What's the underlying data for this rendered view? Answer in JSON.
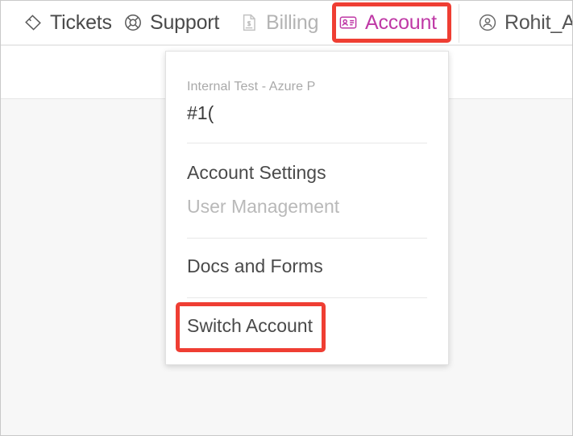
{
  "top_nav": {
    "items": [
      {
        "id": "tickets",
        "label": "Tickets",
        "icon": "ticket-icon",
        "state": "default"
      },
      {
        "id": "support",
        "label": "Support",
        "icon": "lifebuoy-icon",
        "state": "default"
      },
      {
        "id": "billing",
        "label": "Billing",
        "icon": "invoice-icon",
        "state": "disabled"
      },
      {
        "id": "account",
        "label": "Account",
        "icon": "id-card-icon",
        "state": "active"
      },
      {
        "id": "user",
        "label": "Rohit_A",
        "icon": "user-circle-icon",
        "state": "default"
      }
    ]
  },
  "account_dropdown": {
    "org_name": "Internal Test - Azure P",
    "account_id": "#1(",
    "items": [
      {
        "id": "account-settings",
        "label": "Account Settings",
        "state": "default"
      },
      {
        "id": "user-management",
        "label": "User Management",
        "state": "disabled"
      },
      {
        "id": "docs-and-forms",
        "label": "Docs and Forms",
        "state": "default"
      },
      {
        "id": "switch-account",
        "label": "Switch Account",
        "state": "default"
      }
    ]
  },
  "annotations": [
    {
      "id": "account-highlight",
      "target": "Account",
      "color": "#ef3e33"
    },
    {
      "id": "switch-account-highlight",
      "target": "Switch Account",
      "color": "#ef3e33"
    }
  ],
  "colors": {
    "accent_magenta": "#bf39a6",
    "annotation_red": "#ef3e33",
    "text_primary": "#4a4a4a",
    "text_disabled": "#b9b9b9",
    "page_background": "#f7f7f7"
  }
}
